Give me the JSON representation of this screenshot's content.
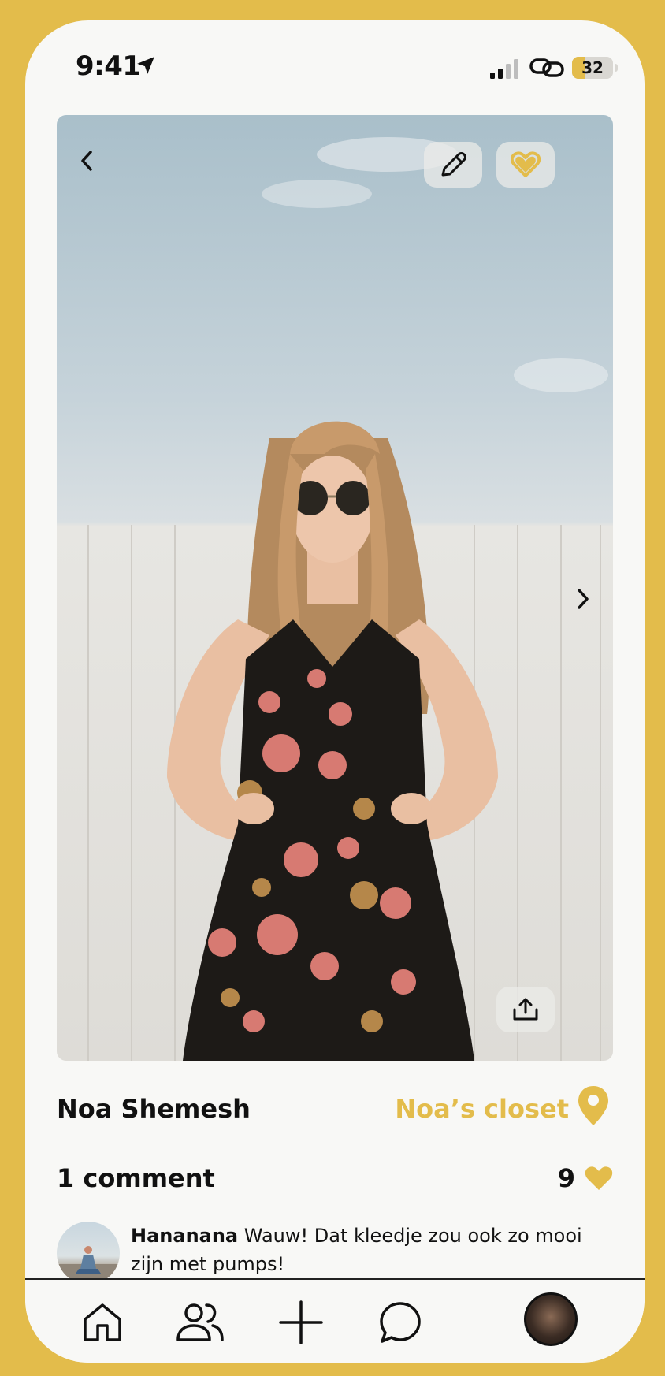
{
  "status_bar": {
    "time": "9:41",
    "battery_level": "32",
    "battery_fraction": 0.32
  },
  "photo": {
    "alt": "Photo of a woman in a floral dress",
    "icons": [
      "chevron-left-icon",
      "pencil-icon",
      "heart-icon",
      "chevron-right-icon",
      "share-icon"
    ]
  },
  "post": {
    "owner_name": "Noa Shemesh",
    "closet_label": "Noa’s closet",
    "comments_label": "1 comment",
    "likes_count": "9"
  },
  "comments": [
    {
      "author": "Hananana",
      "text": "Wauw! Dat kleedje zou ook zo mooi zijn met pumps!"
    }
  ],
  "tabbar": {
    "items": [
      "home-icon",
      "friends-icon",
      "add-icon",
      "chat-icon",
      "profile-avatar"
    ]
  },
  "colors": {
    "accent": "#e3bc4b",
    "background": "#f8f8f6",
    "text": "#111111"
  }
}
